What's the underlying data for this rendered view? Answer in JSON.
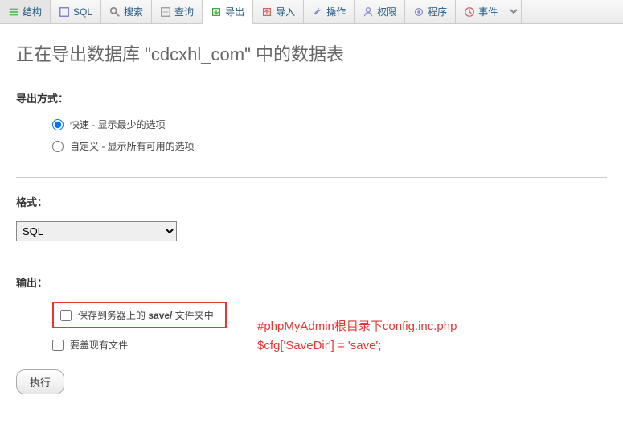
{
  "tabs": [
    {
      "label": "结构",
      "icon_color": "#8e8"
    },
    {
      "label": "SQL",
      "icon_color": "#88d"
    },
    {
      "label": "搜索",
      "icon_color": "#aaa"
    },
    {
      "label": "查询",
      "icon_color": "#aaa"
    },
    {
      "label": "导出",
      "icon_color": "#4a4",
      "active": true
    },
    {
      "label": "导入",
      "icon_color": "#d88"
    },
    {
      "label": "操作",
      "icon_color": "#88d"
    },
    {
      "label": "权限",
      "icon_color": "#88d"
    },
    {
      "label": "程序",
      "icon_color": "#88d"
    },
    {
      "label": "事件",
      "icon_color": "#d88"
    }
  ],
  "heading": "正在导出数据库 \"cdcxhl_com\" 中的数据表",
  "export_method": {
    "label": "导出方式：",
    "options": [
      {
        "label": "快速 - 显示最少的选项",
        "checked": true
      },
      {
        "label": "自定义 - 显示所有可用的选项",
        "checked": false
      }
    ]
  },
  "format": {
    "label": "格式：",
    "selected": "SQL"
  },
  "output": {
    "label": "输出：",
    "save_option_prefix": "保存到务器上的 ",
    "save_option_bold": "save/",
    "save_option_suffix": " 文件夹中",
    "overwrite_option": "要盖现有文件"
  },
  "annotation": {
    "line1": "#phpMyAdmin根目录下config.inc.php",
    "line2": "$cfg['SaveDir'] = 'save';"
  },
  "submit_label": "执行"
}
